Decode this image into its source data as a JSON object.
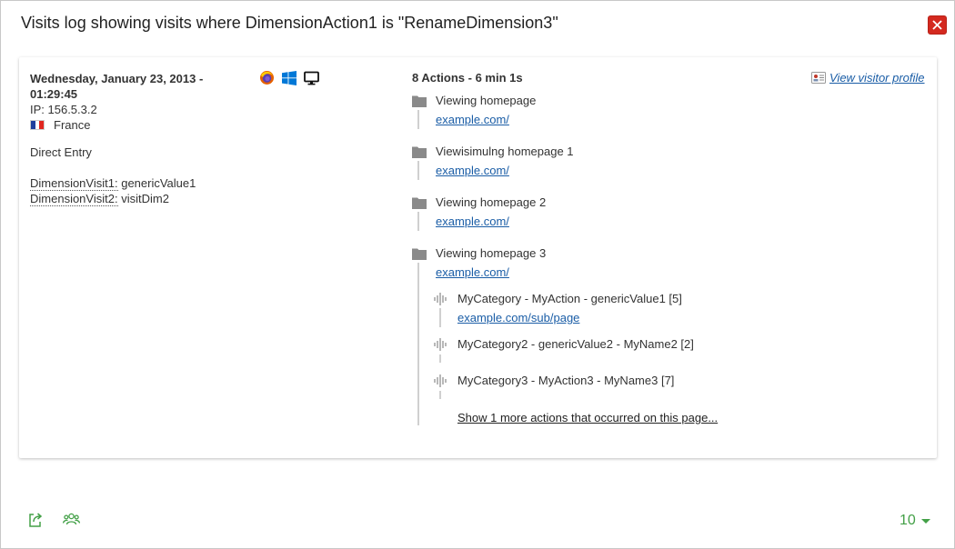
{
  "dialog": {
    "title": "Visits log showing visits where DimensionAction1 is \"RenameDimension3\"",
    "close_icon": "close-icon",
    "close_color": "#d4291f"
  },
  "visit": {
    "date_line1": "Wednesday, January 23, 2013 -",
    "date_line2": "01:29:45",
    "ip": "IP: 156.5.3.2",
    "country": "France",
    "referrer": "Direct Entry",
    "dimensions": [
      {
        "label": "DimensionVisit1:",
        "value": "genericValue1"
      },
      {
        "label": "DimensionVisit2:",
        "value": "visitDim2"
      }
    ],
    "icons": [
      "firefox-icon",
      "windows-icon",
      "desktop-icon"
    ]
  },
  "actions": {
    "summary": "8 Actions - 6 min 1s",
    "profile_link": "View visitor profile",
    "pages": [
      {
        "title": "Viewing homepage",
        "url": "example.com/"
      },
      {
        "title": "Viewisimulng homepage 1",
        "url": "example.com/"
      },
      {
        "title": "Viewing homepage 2",
        "url": "example.com/"
      },
      {
        "title": "Viewing homepage 3",
        "url": "example.com/"
      }
    ],
    "events": [
      {
        "title": "MyCategory - MyAction - genericValue1 [5]",
        "url": "example.com/sub/page"
      },
      {
        "title": "MyCategory2 - genericValue2 - MyName2 [2]",
        "url": ""
      },
      {
        "title": "MyCategory3 - MyAction3 - MyName3 [7]",
        "url": ""
      }
    ],
    "more_link": "Show 1 more actions that occurred on this page..."
  },
  "footer": {
    "export_icon": "export-icon",
    "segment_icon": "visitors-icon",
    "page_size": "10",
    "accent": "#43a047"
  }
}
